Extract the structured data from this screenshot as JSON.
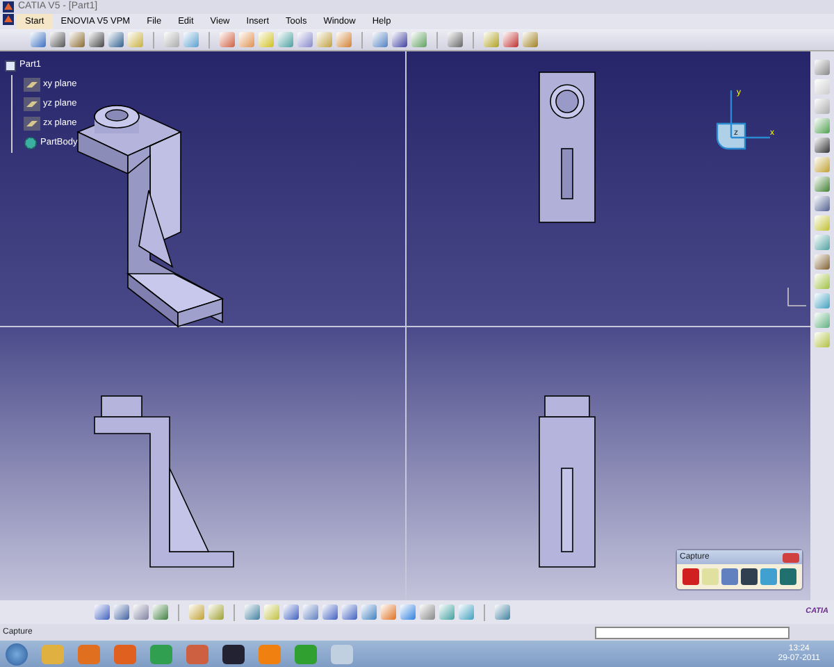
{
  "window": {
    "title": "CATIA V5 - [Part1]"
  },
  "menu": [
    {
      "label": "Start",
      "selected": true
    },
    {
      "label": "ENOVIA V5 VPM",
      "selected": false
    },
    {
      "label": "File",
      "selected": false
    },
    {
      "label": "Edit",
      "selected": false
    },
    {
      "label": "View",
      "selected": false
    },
    {
      "label": "Insert",
      "selected": false
    },
    {
      "label": "Tools",
      "selected": false
    },
    {
      "label": "Window",
      "selected": false
    },
    {
      "label": "Help",
      "selected": false
    }
  ],
  "tree": {
    "label": "Part1",
    "children": [
      {
        "label": "xy plane",
        "kind": "plane"
      },
      {
        "label": "yz plane",
        "kind": "plane"
      },
      {
        "label": "zx plane",
        "kind": "plane"
      },
      {
        "label": "PartBody",
        "kind": "body"
      }
    ]
  },
  "compass": {
    "x_label": "x",
    "y_label": "y",
    "z_label": "z"
  },
  "capture_toolbar": {
    "title": "Capture"
  },
  "brand": {
    "logo": "CATIA"
  },
  "status_bar": {
    "text": "Capture"
  },
  "taskbar": {
    "time": "13:24",
    "date": "29-07-2011"
  }
}
